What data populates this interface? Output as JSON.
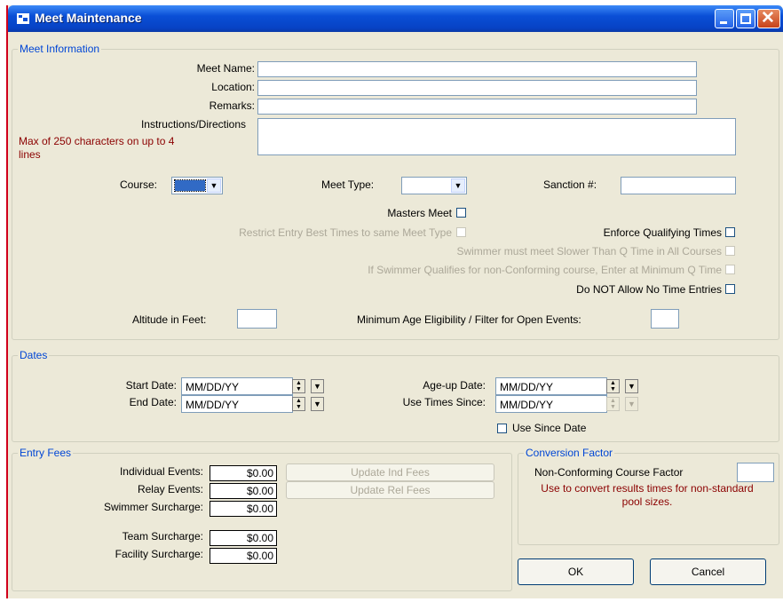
{
  "window": {
    "title": "Meet Maintenance"
  },
  "meet_info": {
    "legend": "Meet Information",
    "meet_name_label": "Meet Name:",
    "location_label": "Location:",
    "remarks_label": "Remarks:",
    "instructions_label": "Instructions/Directions",
    "instructions_note": "Max of 250 characters on up to 4 lines",
    "course_label": "Course:",
    "meet_type_label": "Meet Type:",
    "sanction_label": "Sanction #:",
    "masters_label": "Masters Meet",
    "restrict_label": "Restrict Entry Best Times to same Meet Type",
    "enforce_label": "Enforce Qualifying Times",
    "slower_label": "Swimmer must meet Slower Than Q Time in All Courses",
    "nonconf_label": "If Swimmer Qualifies for non-Conforming course, Enter at Minimum Q Time",
    "notime_label": "Do NOT Allow No Time Entries",
    "altitude_label": "Altitude in Feet:",
    "min_age_label": "Minimum Age Eligibility / Filter for Open Events:"
  },
  "dates": {
    "legend": "Dates",
    "start_label": "Start Date:",
    "start_value": "MM/DD/YY",
    "end_label": "End Date:",
    "end_value": "MM/DD/YY",
    "ageup_label": "Age-up Date:",
    "ageup_value": "MM/DD/YY",
    "since_label": "Use Times Since:",
    "since_value": "MM/DD/YY",
    "use_since_label": "Use Since Date"
  },
  "fees": {
    "legend": "Entry Fees",
    "individual_label": "Individual Events:",
    "individual_value": "$0.00",
    "relay_label": "Relay Events:",
    "relay_value": "$0.00",
    "swimmer_label": "Swimmer Surcharge:",
    "swimmer_value": "$0.00",
    "team_label": "Team Surcharge:",
    "team_value": "$0.00",
    "facility_label": "Facility Surcharge:",
    "facility_value": "$0.00",
    "update_ind": "Update Ind Fees",
    "update_rel": "Update Rel Fees"
  },
  "conversion": {
    "legend": "Conversion Factor",
    "factor_label": "Non-Conforming Course Factor",
    "note": "Use to convert results times for non-standard pool sizes."
  },
  "buttons": {
    "ok": "OK",
    "cancel": "Cancel"
  },
  "colors": {
    "legend": "#0046d5",
    "note": "#8b0000",
    "selection": "#316ac5"
  }
}
